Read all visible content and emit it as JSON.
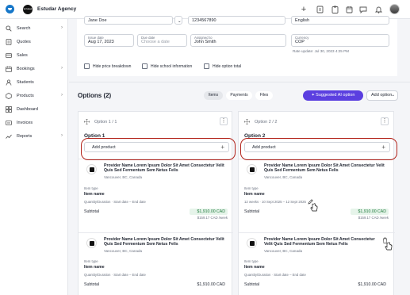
{
  "topbar": {
    "agency_logo_text": "ESTUDAR",
    "agency_name": "Estudar Agency",
    "icons": [
      "plus-icon",
      "bookmark-icon",
      "clipboard-icon",
      "calendar-icon",
      "chat-icon",
      "bell-icon"
    ]
  },
  "sidebar": {
    "items": [
      {
        "label": "Search",
        "icon": "search-icon",
        "chevron": true
      },
      {
        "label": "Quotes",
        "icon": "quotes-icon",
        "chevron": false
      },
      {
        "label": "Sales",
        "icon": "sales-icon",
        "chevron": false
      },
      {
        "label": "Bookings",
        "icon": "bookings-icon",
        "chevron": true
      },
      {
        "label": "Students",
        "icon": "students-icon",
        "chevron": false
      },
      {
        "label": "Products",
        "icon": "products-icon",
        "chevron": true
      },
      {
        "label": "Dashboard",
        "icon": "dashboard-icon",
        "chevron": false
      },
      {
        "label": "Invoices",
        "icon": "invoices-icon",
        "chevron": false
      },
      {
        "label": "Reports",
        "icon": "reports-icon",
        "chevron": true
      }
    ]
  },
  "form": {
    "student_name": "Jane Doe",
    "phone": "1234567890",
    "language": "English",
    "issue_date_label": "Issue date",
    "issue_date": "Aug 17, 2023",
    "due_date_label": "Due date",
    "due_date_placeholder": "Choose a date",
    "assigned_label": "Assigned to",
    "assigned": "John Smith",
    "currency_label": "Currency",
    "currency": "COP",
    "rate_update": "Rate update: Jul 30, 2023 4:25 PM",
    "checkboxes": [
      "Hide price breakdown",
      "Hide school information",
      "Hide option total"
    ]
  },
  "options": {
    "title": "Options (2)",
    "tabs": [
      "Items",
      "Payments",
      "Files"
    ],
    "ai_button": "Suggested AI option",
    "add_option": "Add option",
    "columns": [
      {
        "header": "Option 1 / 1",
        "name": "Option 1",
        "add_product": "Add product",
        "cards": [
          {
            "provider": "Provider Name Lorem Ipsum Dolor Sit Amet Consectetur Velit Quis Sed Fermentum Sem Netus Felis",
            "location": "Vancouver, BC, Canada",
            "item_type_label": "Item type",
            "item_name": "Item name",
            "detail": "Quantity/Duration · Start date – End date",
            "subtotal_label": "Subtotal",
            "price": "$1,910.00 CAD",
            "per_week": "$159.17 CAD /week"
          },
          {
            "provider": "Provider Name Lorem Ipsum Dolor Sit Amet Consectetur Velit Quis Sed Fermentum Sem Netus Felis",
            "location": "Vancouver, BC, Canada",
            "item_type_label": "Item type",
            "item_name": "Item name",
            "detail": "Quantity/Duration · Start date – End date",
            "subtotal_label": "Subtotal",
            "price": "$1,910.00 CAD",
            "per_week": ""
          }
        ]
      },
      {
        "header": "Option 2 / 2",
        "name": "Option 2",
        "add_product": "Add product",
        "cards": [
          {
            "provider": "Provider Name Lorem Ipsum Dolor Sit Amet Consectetur Velit Quis Sed Fermentum Sem Netus Felis",
            "location": "Vancouver, BC, Canada",
            "item_type_label": "Item type",
            "item_name": "Item name",
            "detail": "12 weeks · 10 Sept 2025 – 12 Sept 2025",
            "subtotal_label": "Subtotal",
            "price": "$1,910.00 CAD",
            "per_week": "$159.17 CAD /week"
          },
          {
            "provider": "Provider Name Lorem Ipsum Dolor Sit Amet Consectetur Velit Quis Sed Fermentum Sem Netus Felis",
            "location": "Vancouver, BC, Canada",
            "item_type_label": "Item type",
            "item_name": "Item name",
            "detail": "Quantity/Duration · Start date – End date",
            "subtotal_label": "Subtotal",
            "price": "$1,910.00 CAD",
            "per_week": ""
          }
        ]
      }
    ]
  },
  "colors": {
    "brand_blue": "#1677c9",
    "ai_purple": "#5b3fe0",
    "highlight_red": "#b3241b",
    "price_green": "#1e7a3c"
  }
}
